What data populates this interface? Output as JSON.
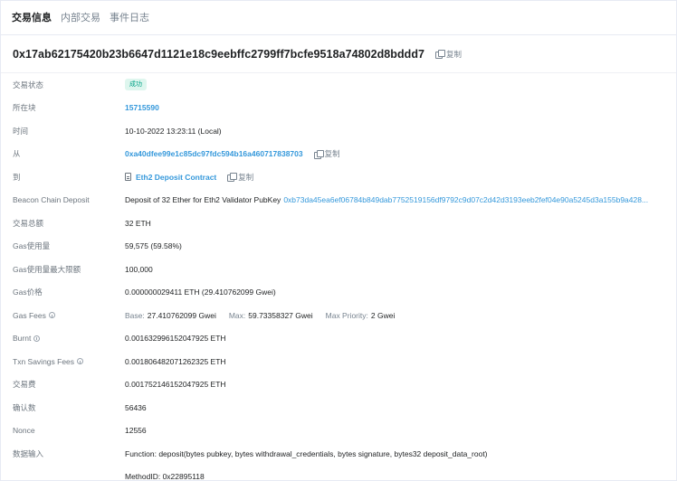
{
  "tabs": [
    {
      "label": "交易信息",
      "active": true
    },
    {
      "label": "内部交易",
      "active": false
    },
    {
      "label": "事件日志",
      "active": false
    }
  ],
  "tx_hash": "0x17ab62175420b23b6647d1121e18c9eebffc2799ff7bcfe9518a74802d8bddd7",
  "copy_label": "复制",
  "fields": {
    "status": {
      "label": "交易状态",
      "value": "成功"
    },
    "block": {
      "label": "所在块",
      "value": "15715590"
    },
    "time": {
      "label": "时间",
      "value": "10-10-2022 13:23:11 (Local)"
    },
    "from": {
      "label": "从",
      "value": "0xa40dfee99e1c85dc97fdc594b16a460717838703"
    },
    "to": {
      "label": "到",
      "value": "Eth2 Deposit Contract"
    },
    "beacon": {
      "label": "Beacon Chain Deposit",
      "text": "Deposit of 32 Ether for Eth2 Validator PubKey",
      "pubkey": "0xb73da45ea6ef06784b849dab7752519156df9792c9d07c2d42d3193eeb2fef04e90a5245d3a155b9a428..."
    },
    "amount": {
      "label": "交易总额",
      "value": "32 ETH"
    },
    "gas_used": {
      "label": "Gas使用量",
      "value": "59,575 (59.58%)"
    },
    "gas_limit": {
      "label": "Gas使用量最大限额",
      "value": "100,000"
    },
    "gas_price": {
      "label": "Gas价格",
      "value": "0.000000029411 ETH (29.410762099 Gwei)"
    },
    "gas_fees": {
      "label": "Gas Fees",
      "base_label": "Base:",
      "base": "27.410762099 Gwei",
      "max_label": "Max:",
      "max": "59.73358327 Gwei",
      "priority_label": "Max Priority:",
      "priority": "2 Gwei"
    },
    "burnt": {
      "label": "Burnt",
      "value": "0.001632996152047925 ETH"
    },
    "savings": {
      "label": "Txn Savings Fees",
      "value": "0.001806482071262325 ETH"
    },
    "fee": {
      "label": "交易费",
      "value": "0.001752146152047925 ETH"
    },
    "confirmations": {
      "label": "确认数",
      "value": "56436"
    },
    "nonce": {
      "label": "Nonce",
      "value": "12556"
    },
    "input": {
      "label": "数据输入",
      "function": "Function: deposit(bytes pubkey, bytes withdrawal_credentials, bytes signature, bytes32 deposit_data_root)",
      "method_id": "MethodID: 0x22895118"
    }
  },
  "colors": {
    "link": "#3498db",
    "success_bg": "#def6ee",
    "success_text": "#00a186"
  }
}
